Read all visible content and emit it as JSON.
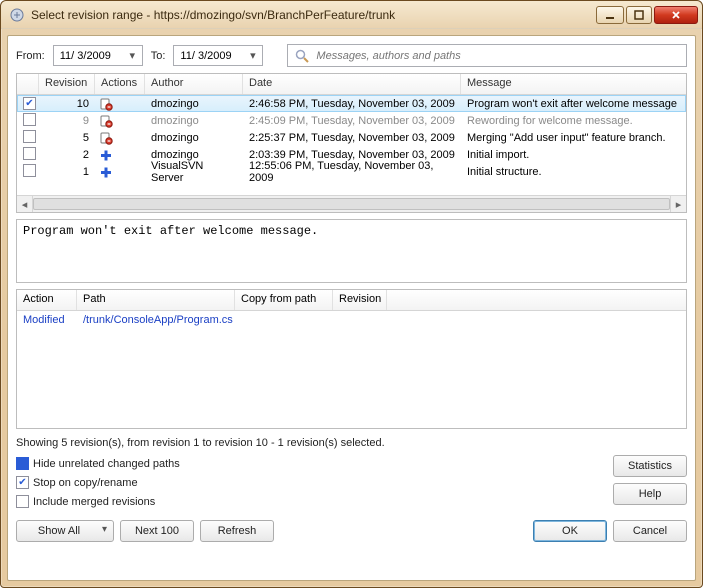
{
  "title": "Select revision range - https://dmozingo/svn/BranchPerFeature/trunk",
  "filters": {
    "from_label": "From:",
    "from_value": "11/ 3/2009",
    "to_label": "To:",
    "to_value": "11/ 3/2009",
    "search_placeholder": "Messages, authors and paths"
  },
  "columns": {
    "revision": "Revision",
    "actions": "Actions",
    "author": "Author",
    "date": "Date",
    "message": "Message"
  },
  "revisions": [
    {
      "num": "10",
      "author": "dmozingo",
      "date": "2:46:58 PM, Tuesday, November 03, 2009",
      "message": "Program won't exit after welcome message",
      "selected": true,
      "checked": true,
      "grey": false,
      "icon": "modify"
    },
    {
      "num": "9",
      "author": "dmozingo",
      "date": "2:45:09 PM, Tuesday, November 03, 2009",
      "message": "Rewording for welcome message.",
      "selected": false,
      "checked": false,
      "grey": true,
      "icon": "modify"
    },
    {
      "num": "5",
      "author": "dmozingo",
      "date": "2:25:37 PM, Tuesday, November 03, 2009",
      "message": "Merging \"Add user input\" feature branch.",
      "selected": false,
      "checked": false,
      "grey": false,
      "icon": "modify"
    },
    {
      "num": "2",
      "author": "dmozingo",
      "date": "2:03:39 PM, Tuesday, November 03, 2009",
      "message": "Initial import.",
      "selected": false,
      "checked": false,
      "grey": false,
      "icon": "add"
    },
    {
      "num": "1",
      "author": "VisualSVN Server",
      "date": "12:55:06 PM, Tuesday, November 03, 2009",
      "message": "Initial structure.",
      "selected": false,
      "checked": false,
      "grey": false,
      "icon": "add"
    }
  ],
  "commit_message": "Program won't exit after welcome message.",
  "path_columns": {
    "action": "Action",
    "path": "Path",
    "copy_from": "Copy from path",
    "revision": "Revision"
  },
  "paths": [
    {
      "action": "Modified",
      "path": "/trunk/ConsoleApp/Program.cs",
      "copy_from": "",
      "revision": ""
    }
  ],
  "status_text": "Showing 5 revision(s), from revision 1 to revision 10 - 1 revision(s) selected.",
  "checkboxes": {
    "hide_unrelated": "Hide unrelated changed paths",
    "stop_on_copy": "Stop on copy/rename",
    "include_merged": "Include merged revisions"
  },
  "buttons": {
    "statistics": "Statistics",
    "help": "Help",
    "show_all": "Show All",
    "next_100": "Next 100",
    "refresh": "Refresh",
    "ok": "OK",
    "cancel": "Cancel"
  }
}
